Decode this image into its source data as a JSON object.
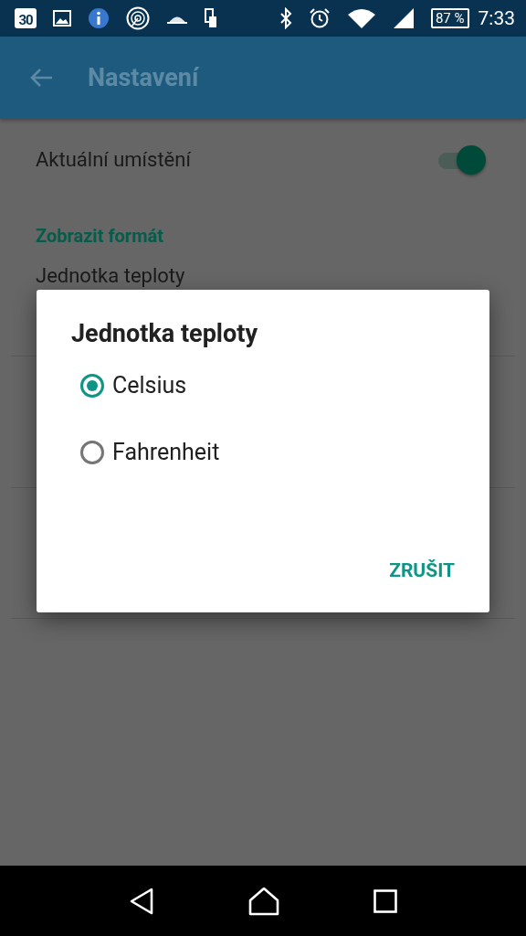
{
  "status_bar": {
    "calendar_day": "30",
    "battery": "87 %",
    "time": "7:33"
  },
  "app_bar": {
    "title": "Nastavení"
  },
  "settings": [
    {
      "kind": "switch",
      "label": "Aktuální umístění",
      "on": true
    },
    {
      "kind": "header",
      "label": "Zobrazit formát"
    },
    {
      "kind": "item",
      "label": "Jednotka teploty"
    }
  ],
  "dialog": {
    "title": "Jednotka teploty",
    "options": [
      {
        "label": "Celsius",
        "selected": true
      },
      {
        "label": "Fahrenheit",
        "selected": false
      }
    ],
    "buttons": [
      "ZRUŠIT"
    ]
  }
}
